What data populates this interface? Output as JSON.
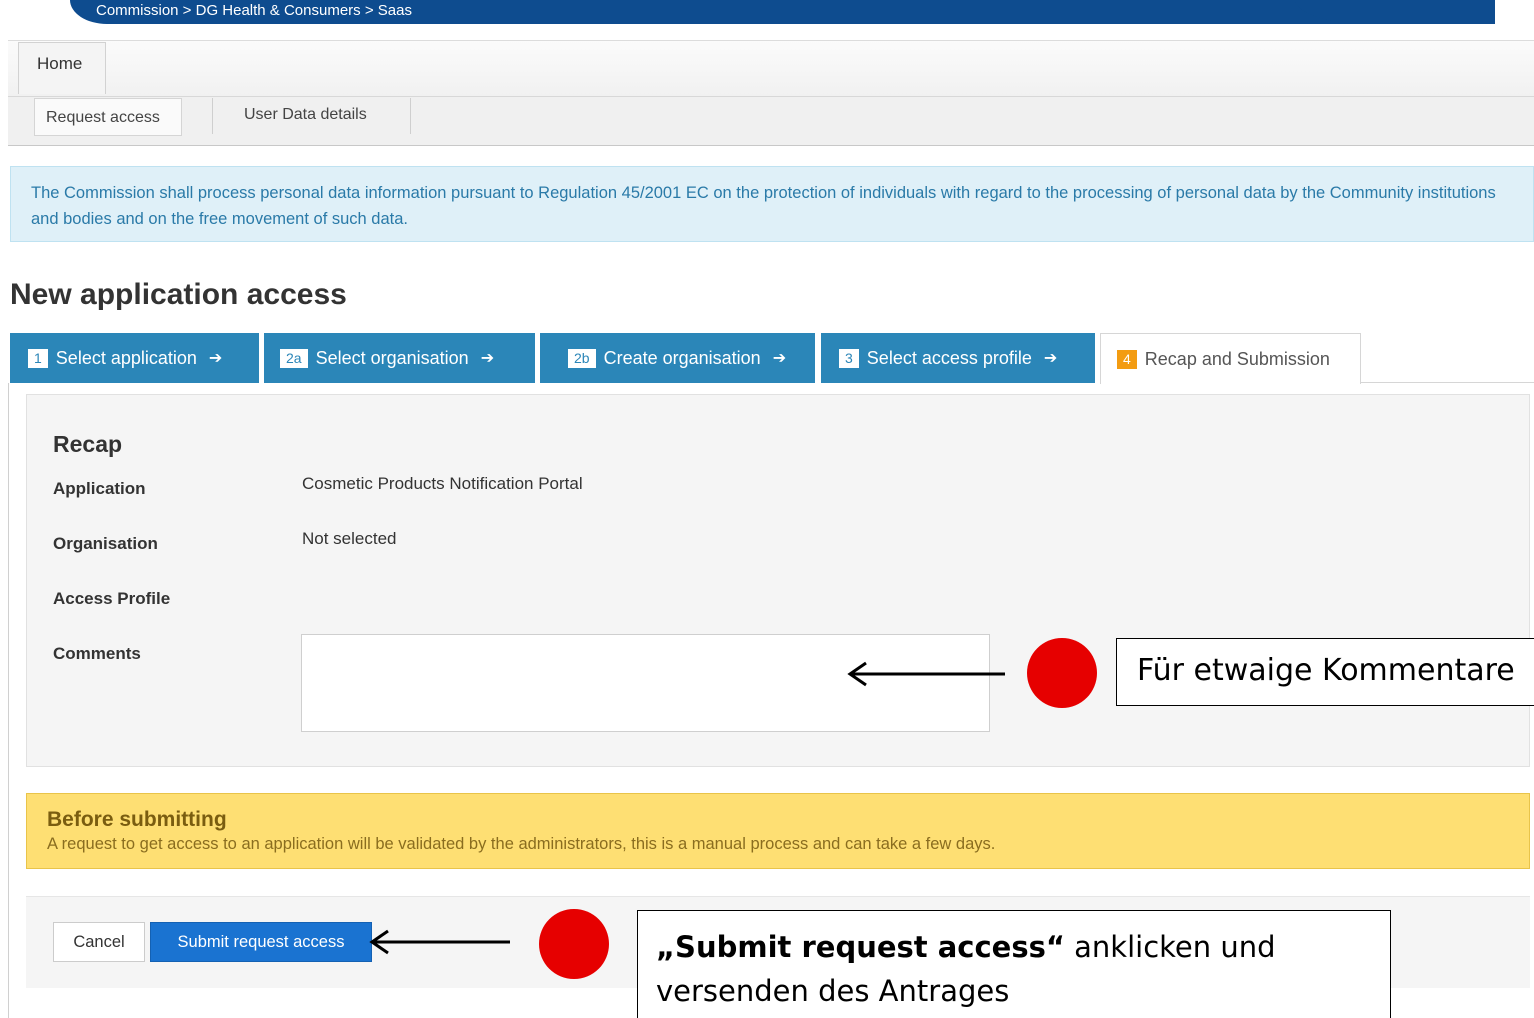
{
  "breadcrumb": "Commission > DG Health & Consumers > Saas",
  "tabs": {
    "home": "Home"
  },
  "subtabs": [
    "Request access",
    "User Data details"
  ],
  "notice": "The Commission shall process personal data information pursuant to Regulation 45/2001 EC on the protection of individuals with regard to the processing of personal data by the Community institutions and bodies and on the free movement of such data.",
  "page_title": "New application access",
  "steps": [
    {
      "num": "1",
      "label": "Select application",
      "arrow": "➔"
    },
    {
      "num": "2a",
      "label": "Select organisation",
      "arrow": "➔"
    },
    {
      "num": "2b",
      "label": "Create organisation",
      "arrow": "➔"
    },
    {
      "num": "3",
      "label": "Select access profile",
      "arrow": "➔"
    },
    {
      "num": "4",
      "label": "Recap and Submission"
    }
  ],
  "recap": {
    "title": "Recap",
    "application_label": "Application",
    "application_value": "Cosmetic Products Notification Portal",
    "organisation_label": "Organisation",
    "organisation_value": "Not selected",
    "access_profile_label": "Access Profile",
    "comments_label": "Comments",
    "comments_value": ""
  },
  "warning": {
    "title": "Before submitting",
    "text": "A request to get access to an application will be validated by the administrators, this is a manual process and can take a few days."
  },
  "actions": {
    "cancel": "Cancel",
    "submit": "Submit request access"
  },
  "annotations": {
    "comments_note": "Für etwaige Kommentare",
    "submit_note_bold": "„Submit request access“",
    "submit_note_rest": " anklicken  und versenden des Antrages"
  },
  "colors": {
    "banner": "#0e4c8f",
    "step_blue": "#2b86b8",
    "step_active_badge": "#f39c12",
    "notice_bg": "#dff0f8",
    "warning_bg": "#fedf73",
    "submit_button": "#1a73d1",
    "marker_red": "#e60000"
  }
}
